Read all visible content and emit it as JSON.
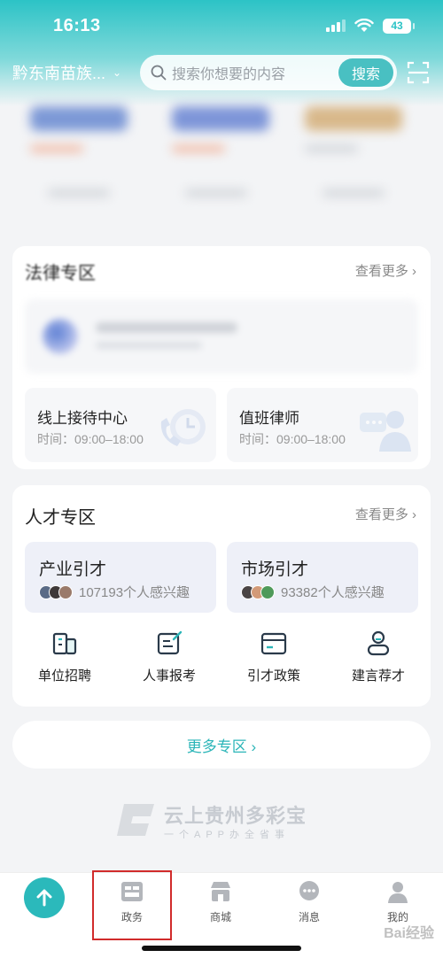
{
  "status_bar": {
    "time": "16:13",
    "battery": "43"
  },
  "header": {
    "location": "黔东南苗族...",
    "search_placeholder": "搜索你想要的内容",
    "search_button": "搜索"
  },
  "law": {
    "title": "法律专区",
    "more": "查看更多 ›",
    "cards": [
      {
        "title": "线上接待中心",
        "time": "时间：09:00–18:00"
      },
      {
        "title": "值班律师",
        "time": "时间：09:00–18:00"
      }
    ]
  },
  "talent": {
    "title": "人才专区",
    "more": "查看更多 ›",
    "boxes": [
      {
        "title": "产业引才",
        "interest": "107193个人感兴趣"
      },
      {
        "title": "市场引才",
        "interest": "93382个人感兴趣"
      }
    ],
    "grid": [
      {
        "label": "单位招聘",
        "icon": "building-icon"
      },
      {
        "label": "人事报考",
        "icon": "edit-form-icon"
      },
      {
        "label": "引才政策",
        "icon": "card-icon"
      },
      {
        "label": "建言荐才",
        "icon": "person-icon"
      }
    ]
  },
  "more_zones": "更多专区 ›",
  "brand": {
    "name": "云上贵州多彩宝",
    "slogan": "一个APP办全省事"
  },
  "bottom_nav": [
    {
      "label": "政务",
      "icon": "government-icon"
    },
    {
      "label": "商城",
      "icon": "shop-icon"
    },
    {
      "label": "消息",
      "icon": "message-icon"
    },
    {
      "label": "我的",
      "icon": "profile-icon"
    }
  ],
  "colors": {
    "accent": "#2cc3c6",
    "highlight": "#d12b2b"
  },
  "watermark": "Bai经验"
}
